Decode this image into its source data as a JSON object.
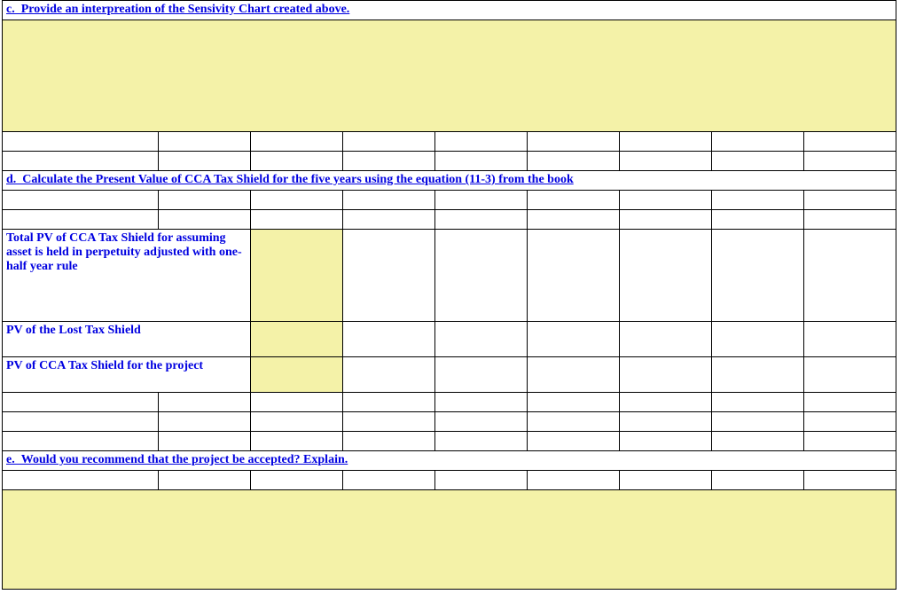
{
  "section_c": {
    "heading": "c.  Provide an interpreation of the Sensivity Chart created above."
  },
  "section_d": {
    "heading": "d.  Calculate the Present Value of CCA Tax Shield for the five years using the equation (11-3) from the book",
    "row1_label": "Total PV of CCA Tax Shield for assuming asset is held in perpetuity adjusted with one-half year rule",
    "row2_label": "PV of the Lost Tax Shield",
    "row3_label": "PV of CCA Tax Shield for the project"
  },
  "section_e": {
    "heading": "e.  Would you recommend that the project be accepted? Explain."
  }
}
